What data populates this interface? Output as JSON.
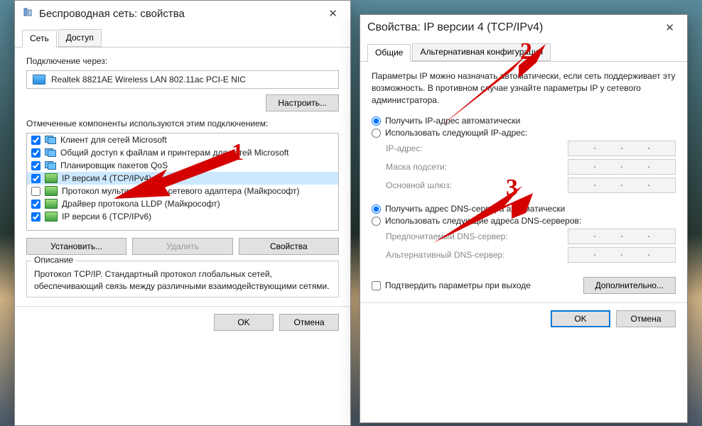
{
  "dialog1": {
    "title": "Беспроводная сеть: свойства",
    "tabs": [
      "Сеть",
      "Доступ"
    ],
    "connect_via_label": "Подключение через:",
    "adapter": "Realtek 8821AE Wireless LAN 802.11ac PCI-E NIC",
    "configure_btn": "Настроить...",
    "components_label": "Отмеченные компоненты используются этим подключением:",
    "components": [
      {
        "label": "Клиент для сетей Microsoft",
        "checked": true,
        "icon": "net"
      },
      {
        "label": "Общий доступ к файлам и принтерам для сетей Microsoft",
        "checked": true,
        "icon": "net"
      },
      {
        "label": "Планировщик пакетов QoS",
        "checked": true,
        "icon": "net"
      },
      {
        "label": "IP версии 4 (TCP/IPv4)",
        "checked": true,
        "icon": "proto",
        "selected": true
      },
      {
        "label": "Протокол мультиплексора сетевого адаптера (Майкрософт)",
        "checked": false,
        "icon": "proto"
      },
      {
        "label": "Драйвер протокола LLDP (Майкрософт)",
        "checked": true,
        "icon": "proto"
      },
      {
        "label": "IP версии 6 (TCP/IPv6)",
        "checked": true,
        "icon": "proto"
      }
    ],
    "install_btn": "Установить...",
    "remove_btn": "Удалить",
    "props_btn": "Свойства",
    "desc_title": "Описание",
    "desc_text": "Протокол TCP/IP. Стандартный протокол глобальных сетей, обеспечивающий связь между различными взаимодействующими сетями.",
    "ok_btn": "OK",
    "cancel_btn": "Отмена"
  },
  "dialog2": {
    "title": "Свойства: IP версии 4 (TCP/IPv4)",
    "tabs": [
      "Общие",
      "Альтернативная конфигурация"
    ],
    "intro": "Параметры IP можно назначать автоматически, если сеть поддерживает эту возможность. В противном случае узнайте параметры IP у сетевого администратора.",
    "ip_auto": "Получить IP-адрес автоматически",
    "ip_manual": "Использовать следующий IP-адрес:",
    "ip_addr": "IP-адрес:",
    "mask": "Маска подсети:",
    "gateway": "Основной шлюз:",
    "dns_auto": "Получить адрес DNS-сервера автоматически",
    "dns_manual": "Использовать следующие адреса DNS-серверов:",
    "dns_pref": "Предпочитаемый DNS-сервер:",
    "dns_alt": "Альтернативный DNS-сервер:",
    "confirm_exit": "Подтвердить параметры при выходе",
    "advanced_btn": "Дополнительно...",
    "ok_btn": "OK",
    "cancel_btn": "Отмена"
  },
  "annotations": {
    "n1": "1",
    "n2": "2",
    "n3": "3"
  }
}
